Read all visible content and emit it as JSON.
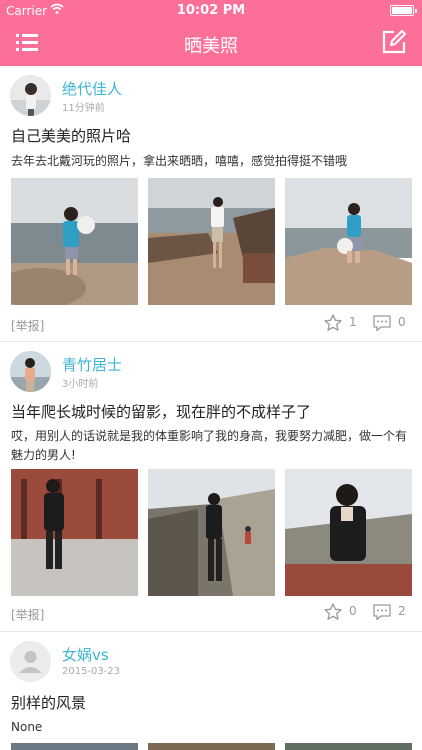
{
  "status_bar": {
    "carrier": "Carrier",
    "time": "10:02 PM"
  },
  "nav": {
    "title": "晒美照",
    "menu_icon": "list-icon",
    "compose_icon": "edit-icon"
  },
  "posts": [
    {
      "username": "绝代佳人",
      "time": "11分钟前",
      "title": "自己美美的照片哈",
      "description": "去年去北戴河玩的照片，拿出来晒晒，嘻嘻，感觉拍得挺不错哦",
      "report": "[举报]",
      "likes": "1",
      "comments": "0"
    },
    {
      "username": "青竹居士",
      "time": "3小时前",
      "title": "当年爬长城时候的留影，现在胖的不成样子了",
      "description": "哎，用别人的话说就是我的体重影响了我的身高，我要努力减肥，做一个有魅力的男人!",
      "report": "[举报]",
      "likes": "0",
      "comments": "2"
    },
    {
      "username": "女娲vs",
      "time": "2015-03-23",
      "title": "别样的风景",
      "description": "None"
    }
  ],
  "colors": {
    "accent": "#fb6f98",
    "username": "#3eb6d6"
  }
}
